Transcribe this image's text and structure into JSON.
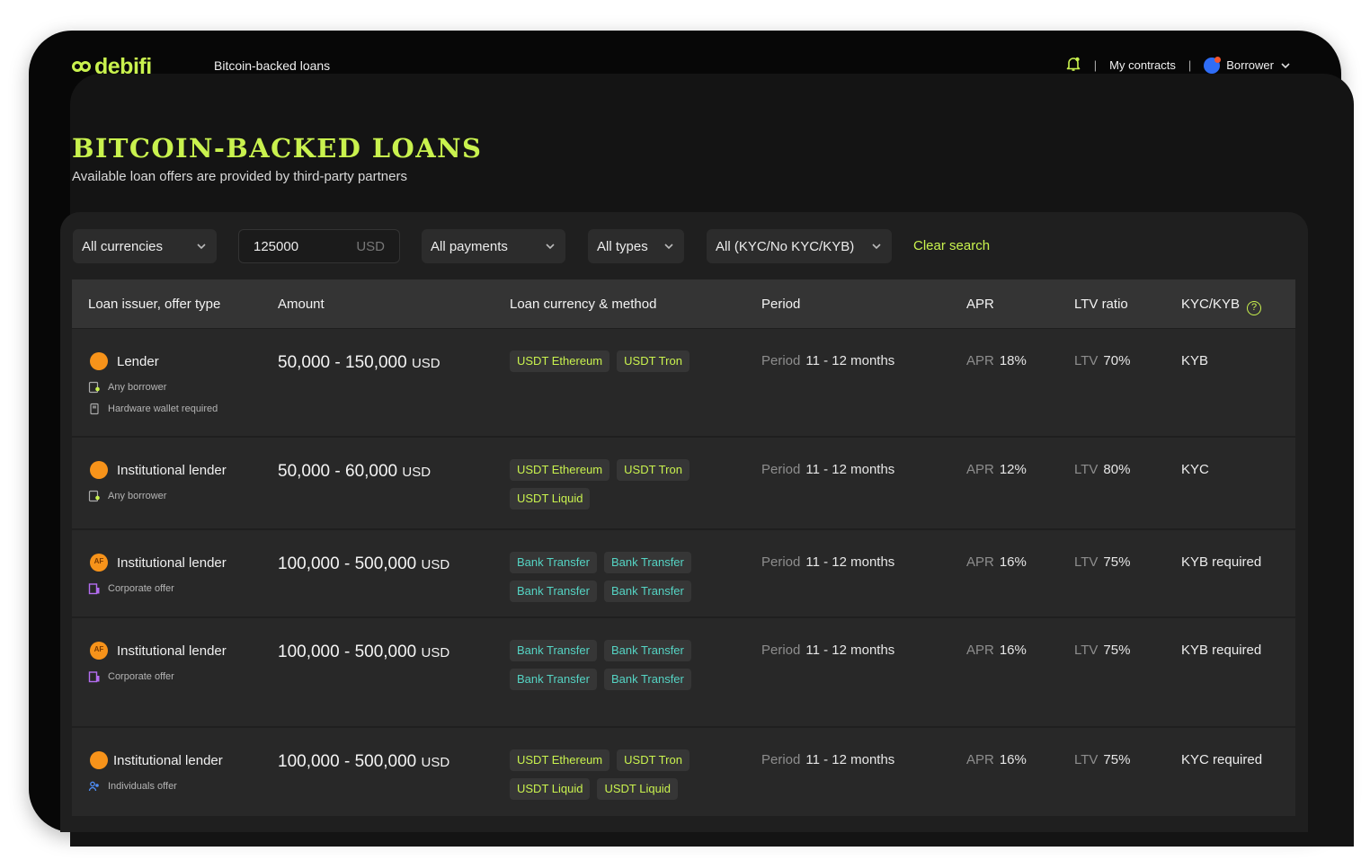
{
  "header": {
    "logo_text": "debifi",
    "app_title": "Bitcoin-backed loans",
    "my_contracts": "My contracts",
    "role": "Borrower",
    "separator": "|"
  },
  "page": {
    "title": "BITCOIN-BACKED LOANS",
    "subtitle": "Available loan offers are provided by third-party partners"
  },
  "filters": {
    "currency": "All currencies",
    "amount_value": "125000",
    "amount_unit": "USD",
    "payments": "All payments",
    "types": "All types",
    "kyc": "All (KYC/No KYC/KYB)",
    "clear": "Clear search"
  },
  "table": {
    "columns": [
      "Loan issuer, offer type",
      "Amount",
      "Loan currency & method",
      "Period",
      "APR",
      "LTV ratio",
      "KYC/KYB"
    ],
    "stat_labels": {
      "period": "Period",
      "apr": "APR",
      "ltv": "LTV"
    },
    "rows": [
      {
        "issuer": "Lender",
        "meta": [
          "Any borrower",
          "Hardware wallet required"
        ],
        "amount": "50,000 - 150,000",
        "currency": "USD",
        "methods": [
          "USDT Ethereum",
          "USDT Tron"
        ],
        "period": "11  - 12 months",
        "apr": "18%",
        "ltv": "70%",
        "kyc": "KYB"
      },
      {
        "issuer": "Institutional lender",
        "meta": [
          "Any borrower"
        ],
        "amount": "50,000 - 60,000",
        "currency": "USD",
        "methods": [
          "USDT Ethereum",
          "USDT Tron",
          "USDT Liquid"
        ],
        "period": "11  - 12 months",
        "apr": "12%",
        "ltv": "80%",
        "kyc": "KYC"
      },
      {
        "issuer": "Institutional lender",
        "meta": [
          "Corporate offer"
        ],
        "amount": "100,000 - 500,000",
        "currency": "USD",
        "methods": [
          "Bank Transfer",
          "Bank Transfer",
          "Bank Transfer",
          "Bank Transfer"
        ],
        "period": "11  - 12 months",
        "apr": "16%",
        "ltv": "75%",
        "kyc": "KYB required"
      },
      {
        "issuer": "Institutional lender",
        "meta": [
          "Corporate offer"
        ],
        "amount": "100,000 - 500,000",
        "currency": "USD",
        "methods": [
          "Bank Transfer",
          "Bank Transfer",
          "Bank Transfer",
          "Bank Transfer"
        ],
        "period": "11  - 12 months",
        "apr": "16%",
        "ltv": "75%",
        "kyc": "KYB required"
      },
      {
        "issuer": "Institutional lender",
        "meta": [
          "Individuals offer"
        ],
        "amount": "100,000 - 500,000",
        "currency": "USD",
        "methods": [
          "USDT Ethereum",
          "USDT Tron",
          "USDT Liquid",
          "USDT Liquid"
        ],
        "period": "11  - 12 months",
        "apr": "16%",
        "ltv": "75%",
        "kyc": "KYC required"
      }
    ]
  },
  "colors": {
    "accent": "#c9f24e",
    "bank_chip": "#55d4c4",
    "bitcoin": "#f7931a"
  },
  "icons": {
    "notification": "bell-icon",
    "any_borrower": "user-doc-icon",
    "hardware_wallet": "wallet-icon",
    "corporate": "building-icon",
    "individuals": "people-icon"
  }
}
